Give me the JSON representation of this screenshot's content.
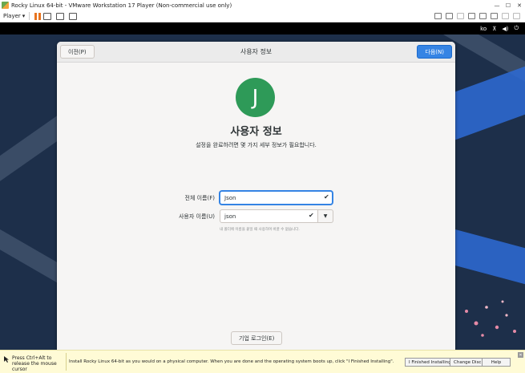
{
  "window": {
    "title": "Rocky Linux 64-bit - VMware Workstation 17 Player (Non-commercial use only)"
  },
  "toolbar": {
    "player_label": "Player",
    "player_caret": "▾"
  },
  "guest_topbar": {
    "language": "ko"
  },
  "dialog": {
    "title": "사용자 정보",
    "prev_label": "이전(P)",
    "next_label": "다음(N)",
    "avatar_letter": "J",
    "heading": "사용자 정보",
    "subtitle": "설정을 완료하려면 몇 가지 세부 정보가 필요합니다.",
    "full_name_label": "전체 이름(F)",
    "full_name_value": "Json",
    "username_label": "사용자 이름(U)",
    "username_value": "json",
    "username_hint": "내 폴더에 이름을 붙일 때 사용하며 바꿀 수 없습니다.",
    "enterprise_login_label": "기업 로그인(E)",
    "check_glyph": "✔",
    "dropdown_glyph": "▼"
  },
  "hintbar": {
    "left_text": "Press Ctrl+Alt to release the mouse cursor",
    "message": "Install Rocky Linux 64-bit as you would on a physical computer. When you are done and the operating system boots up, click \"I Finished Installing\".",
    "finished_label": "I Finished Installing",
    "change_disc_label": "Change Disc",
    "help_label": "Help",
    "close_glyph": "✕"
  },
  "colors": {
    "accent": "#3584e4",
    "avatar": "#2e9a58",
    "desktop": "#1d2f4a",
    "pause": "#e8741e"
  }
}
